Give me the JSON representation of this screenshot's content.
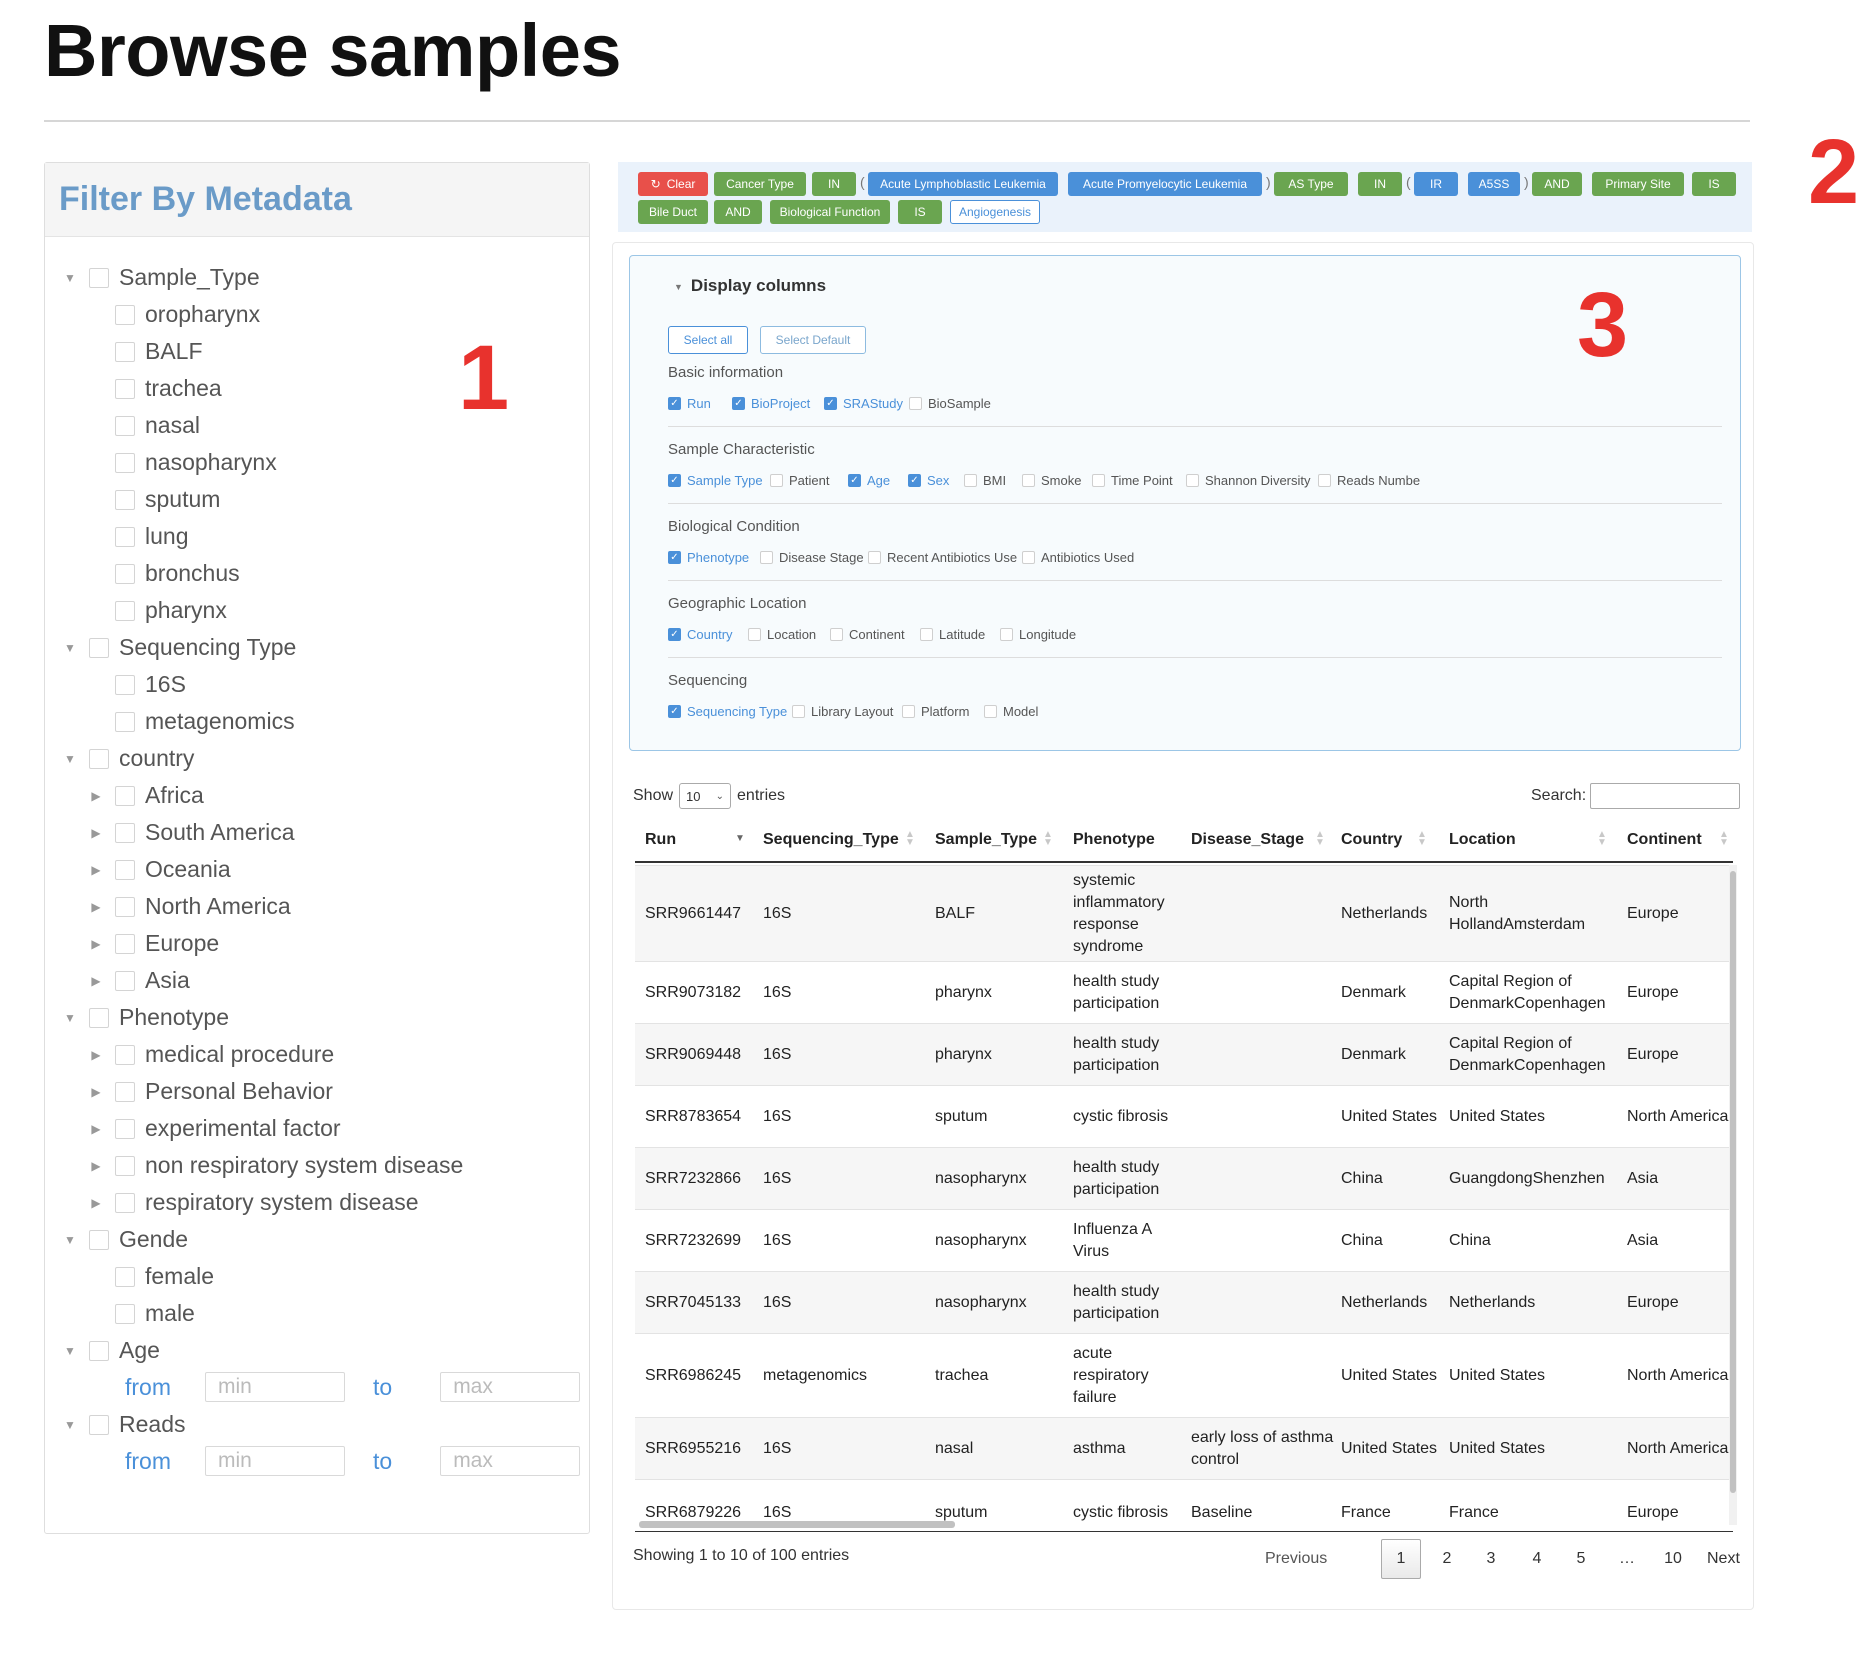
{
  "page": {
    "title": "Browse samples"
  },
  "annotations": {
    "n1": "1",
    "n2": "2",
    "n3": "3"
  },
  "filter": {
    "header": "Filter By Metadata",
    "groups": [
      {
        "label": "Sample_Type",
        "children": [
          "oropharynx",
          "BALF",
          "trachea",
          "nasal",
          "nasopharynx",
          "sputum",
          "lung",
          "bronchus",
          "pharynx"
        ]
      },
      {
        "label": "Sequencing Type",
        "children": [
          "16S",
          "metagenomics"
        ]
      },
      {
        "label": "country",
        "children": [
          "Africa",
          "South America",
          "Oceania",
          "North America",
          "Europe",
          "Asia"
        ]
      },
      {
        "label": "Phenotype",
        "children": [
          "medical procedure",
          "Personal Behavior",
          "experimental factor",
          "non respiratory system disease",
          "respiratory system disease"
        ]
      },
      {
        "label": "Gende",
        "children": [
          "female",
          "male"
        ]
      },
      {
        "label": "Age"
      },
      {
        "label": "Reads"
      }
    ],
    "range": {
      "from": "from",
      "to": "to",
      "min_placeholder": "min",
      "max_placeholder": "max"
    }
  },
  "query": {
    "clear": "Clear",
    "tags": [
      "Cancer Type",
      "IN",
      "(",
      "Acute Lymphoblastic Leukemia",
      "Acute Promyelocytic Leukemia",
      ")",
      "AS Type",
      "IN",
      "(",
      "IR",
      "A5SS",
      ")",
      "AND",
      "Primary Site",
      "IS",
      "Bile Duct",
      "AND",
      "Biological Function",
      "IS",
      "Angiogenesis"
    ]
  },
  "display": {
    "title": "Display columns",
    "select_all": "Select all",
    "select_default": "Select Default",
    "groups": [
      {
        "title": "Basic information",
        "options": [
          {
            "label": "Run",
            "checked": true
          },
          {
            "label": "BioProject",
            "checked": true
          },
          {
            "label": "SRAStudy",
            "checked": true
          },
          {
            "label": "BioSample",
            "checked": false
          }
        ]
      },
      {
        "title": "Sample Characteristic",
        "options": [
          {
            "label": "Sample Type",
            "checked": true
          },
          {
            "label": "Patient",
            "checked": false
          },
          {
            "label": "Age",
            "checked": true
          },
          {
            "label": "Sex",
            "checked": true
          },
          {
            "label": "BMI",
            "checked": false
          },
          {
            "label": "Smoke",
            "checked": false
          },
          {
            "label": "Time Point",
            "checked": false
          },
          {
            "label": "Shannon Diversity",
            "checked": false
          },
          {
            "label": "Reads Numbe",
            "checked": false
          }
        ]
      },
      {
        "title": "Biological Condition",
        "options": [
          {
            "label": "Phenotype",
            "checked": true
          },
          {
            "label": "Disease Stage",
            "checked": false
          },
          {
            "label": "Recent Antibiotics Use",
            "checked": false
          },
          {
            "label": "Antibiotics Used",
            "checked": false
          }
        ]
      },
      {
        "title": "Geographic Location",
        "options": [
          {
            "label": "Country",
            "checked": true
          },
          {
            "label": "Location",
            "checked": false
          },
          {
            "label": "Continent",
            "checked": false
          },
          {
            "label": "Latitude",
            "checked": false
          },
          {
            "label": "Longitude",
            "checked": false
          }
        ]
      },
      {
        "title": "Sequencing",
        "options": [
          {
            "label": "Sequencing Type",
            "checked": true
          },
          {
            "label": "Library Layout",
            "checked": false
          },
          {
            "label": "Platform",
            "checked": false
          },
          {
            "label": "Model",
            "checked": false
          }
        ]
      }
    ]
  },
  "table": {
    "show_label": "Show",
    "entries_label": "entries",
    "page_length": "10",
    "search_label": "Search:",
    "columns": [
      "Run",
      "Sequencing_Type",
      "Sample_Type",
      "Phenotype",
      "Disease_Stage",
      "Country",
      "Location",
      "Continent"
    ],
    "rows": [
      [
        "SRR9661447",
        "16S",
        "BALF",
        "systemic inflammatory response syndrome",
        "",
        "Netherlands",
        "North HollandAmsterdam",
        "Europe"
      ],
      [
        "SRR9073182",
        "16S",
        "pharynx",
        "health study participation",
        "",
        "Denmark",
        "Capital Region of DenmarkCopenhagen",
        "Europe"
      ],
      [
        "SRR9069448",
        "16S",
        "pharynx",
        "health study participation",
        "",
        "Denmark",
        "Capital Region of DenmarkCopenhagen",
        "Europe"
      ],
      [
        "SRR8783654",
        "16S",
        "sputum",
        "cystic fibrosis",
        "",
        "United States",
        "United States",
        "North America"
      ],
      [
        "SRR7232866",
        "16S",
        "nasopharynx",
        "health study participation",
        "",
        "China",
        "GuangdongShenzhen",
        "Asia"
      ],
      [
        "SRR7232699",
        "16S",
        "nasopharynx",
        "Influenza A Virus",
        "",
        "China",
        "China",
        "Asia"
      ],
      [
        "SRR7045133",
        "16S",
        "nasopharynx",
        "health study participation",
        "",
        "Netherlands",
        "Netherlands",
        "Europe"
      ],
      [
        "SRR6986245",
        "metagenomics",
        "trachea",
        "acute respiratory failure",
        "",
        "United States",
        "United States",
        "North America"
      ],
      [
        "SRR6955216",
        "16S",
        "nasal",
        "asthma",
        "early loss of asthma control",
        "United States",
        "United States",
        "North America"
      ],
      [
        "SRR6879226",
        "16S",
        "sputum",
        "cystic fibrosis",
        "Baseline",
        "France",
        "France",
        "Europe"
      ]
    ],
    "info": "Showing 1 to 10 of 100 entries",
    "pagination": {
      "previous": "Previous",
      "next": "Next",
      "pages": [
        "1",
        "2",
        "3",
        "4",
        "5",
        "…",
        "10"
      ],
      "current": "1"
    }
  }
}
